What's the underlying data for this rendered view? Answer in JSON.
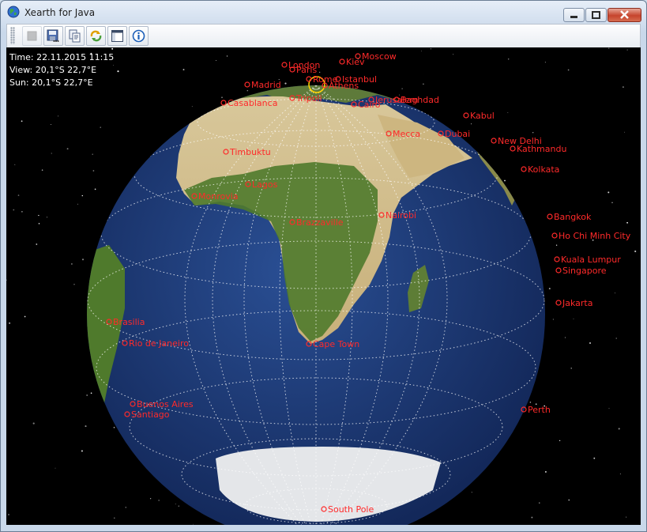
{
  "window": {
    "title": "Xearth for Java"
  },
  "title_controls": [
    "minimize-icon",
    "maximize-icon",
    "close-icon"
  ],
  "toolbar": {
    "buttons": [
      {
        "name": "stop-button",
        "icon": "stop-icon",
        "enabled": false
      },
      {
        "name": "save-image-button",
        "icon": "save-icon",
        "enabled": true
      },
      {
        "name": "copy-button",
        "icon": "copy-icon",
        "enabled": true
      },
      {
        "name": "refresh-button",
        "icon": "refresh-icon",
        "enabled": true
      },
      {
        "name": "settings-button",
        "icon": "window-icon",
        "enabled": true
      },
      {
        "name": "info-button",
        "icon": "info-icon",
        "enabled": true
      }
    ]
  },
  "info": {
    "time": "Time: 22.11.2015 11:15",
    "view": "View: 20,1°S  22,7°E",
    "sun": "Sun: 20,1°S  22,7°E"
  },
  "cities": [
    {
      "label": "Moscow"
    },
    {
      "label": "Kiev"
    },
    {
      "label": "London"
    },
    {
      "label": "Paris"
    },
    {
      "label": "Madrid"
    },
    {
      "label": "Rome"
    },
    {
      "label": "Athens"
    },
    {
      "label": "Istanbul"
    },
    {
      "label": "Casablanca"
    },
    {
      "label": "Tripoli"
    },
    {
      "label": "Cairo"
    },
    {
      "label": "Jerusalem"
    },
    {
      "label": "Baghdad"
    },
    {
      "label": "Kabul"
    },
    {
      "label": "Mecca"
    },
    {
      "label": "Dubai"
    },
    {
      "label": "New Delhi"
    },
    {
      "label": "Kathmandu"
    },
    {
      "label": "Kolkata"
    },
    {
      "label": "Timbuktu"
    },
    {
      "label": "Lagos"
    },
    {
      "label": "Monrovia"
    },
    {
      "label": "Brazzaville"
    },
    {
      "label": "Nairobi"
    },
    {
      "label": "Bangkok"
    },
    {
      "label": "Ho Chi Minh City"
    },
    {
      "label": "Kuala Lumpur"
    },
    {
      "label": "Singapore"
    },
    {
      "label": "Jakarta"
    },
    {
      "label": "Brasilia"
    },
    {
      "label": "Rio de Janeiro"
    },
    {
      "label": "Cape Town"
    },
    {
      "label": "Buenos Aires"
    },
    {
      "label": "Santiago"
    },
    {
      "label": "Perth"
    },
    {
      "label": "South Pole"
    }
  ],
  "colors": {
    "city": "#ff2a2a",
    "ocean": "#1b3a7a",
    "grid": "#ffffff",
    "sun_marker": "#ffd400"
  }
}
